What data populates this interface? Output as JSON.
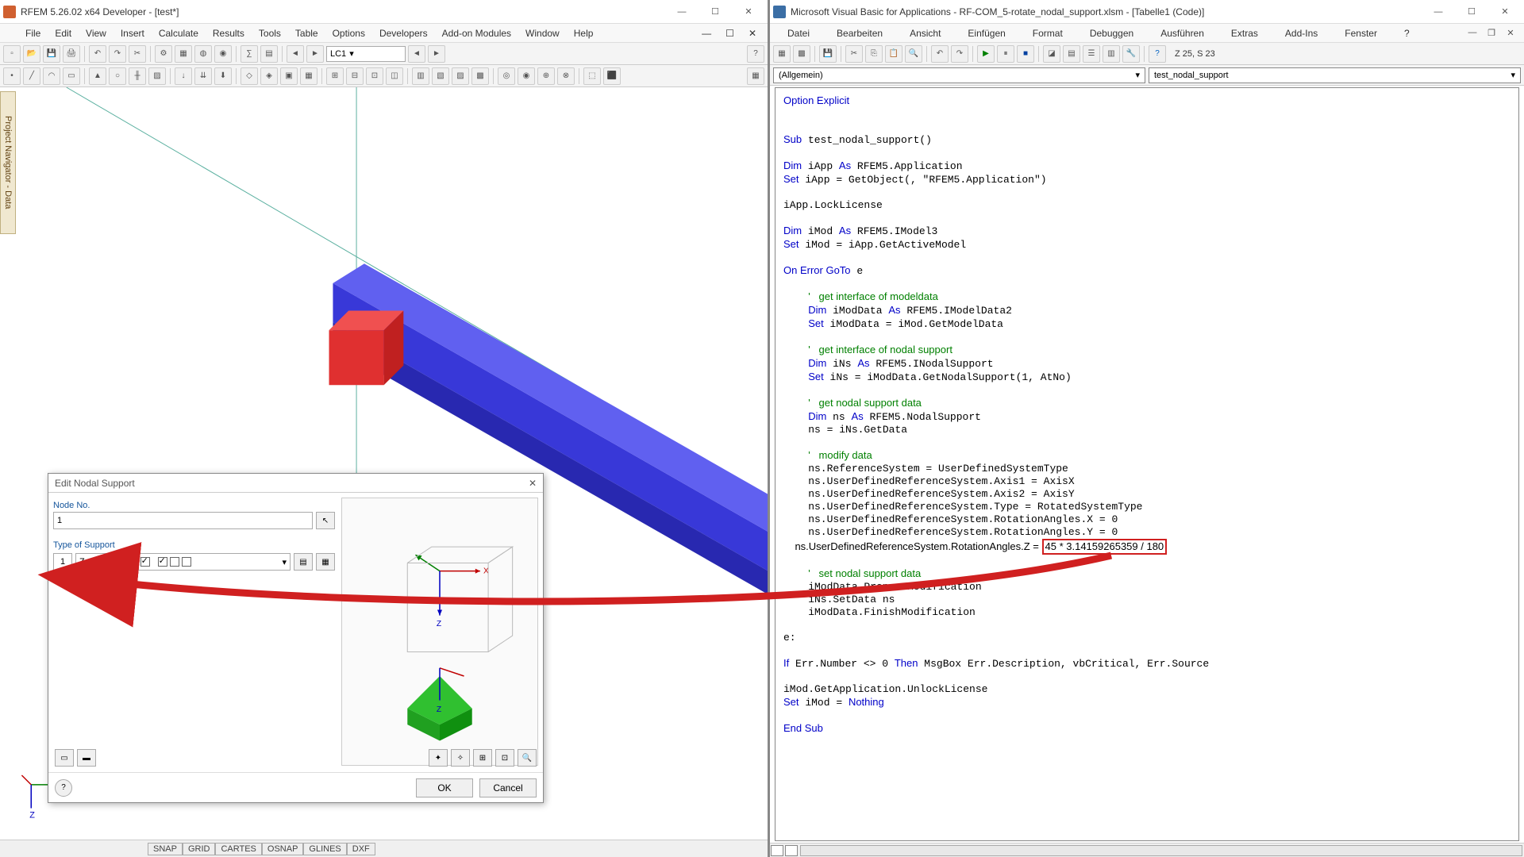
{
  "left": {
    "title": "RFEM 5.26.02 x64 Developer - [test*]",
    "menus": [
      "File",
      "Edit",
      "View",
      "Insert",
      "Calculate",
      "Results",
      "Tools",
      "Table",
      "Options",
      "Developers",
      "Add-on Modules",
      "Window",
      "Help"
    ],
    "toolbar_combo": "LC1",
    "side_tab": "Project Navigator - Data",
    "status": [
      "SNAP",
      "GRID",
      "CARTES",
      "OSNAP",
      "GLINES",
      "DXF"
    ]
  },
  "dialog": {
    "title": "Edit Nodal Support",
    "node_label": "Node No.",
    "node_value": "1",
    "type_label": "Type of Support",
    "type_num": "1",
    "type_text": "Z 45.0 °",
    "ok": "OK",
    "cancel": "Cancel"
  },
  "right": {
    "title": "Microsoft Visual Basic for Applications - RF-COM_5-rotate_nodal_support.xlsm - [Tabelle1 (Code)]",
    "menus": [
      "Datei",
      "Bearbeiten",
      "Ansicht",
      "Einfügen",
      "Format",
      "Debuggen",
      "Ausführen",
      "Extras",
      "Add-Ins",
      "Fenster",
      "?"
    ],
    "cursor": "Z 25, S 23",
    "combo_left": "(Allgemein)",
    "combo_right": "test_nodal_support",
    "highlight": "45 * 3.14159265359 / 180",
    "code_lines": {
      "l0": "Option Explicit",
      "l1": "Sub test_nodal_support()",
      "l2": "Dim iApp As RFEM5.Application",
      "l3": "Set iApp = GetObject(, \"RFEM5.Application\")",
      "l4": "iApp.LockLicense",
      "l5": "Dim iMod As RFEM5.IModel3",
      "l6": "Set iMod = iApp.GetActiveModel",
      "l7": "On Error GoTo e",
      "l8": "'   get interface of modeldata",
      "l9": "Dim iModData As RFEM5.IModelData2",
      "l10": "Set iModData = iMod.GetModelData",
      "l11": "'   get interface of nodal support",
      "l12": "Dim iNs As RFEM5.INodalSupport",
      "l13": "Set iNs = iModData.GetNodalSupport(1, AtNo)",
      "l14": "'   get nodal support data",
      "l15": "Dim ns As RFEM5.NodalSupport",
      "l16": "ns = iNs.GetData",
      "l17": "'   modify data",
      "l18": "ns.ReferenceSystem = UserDefinedSystemType",
      "l19": "ns.UserDefinedReferenceSystem.Axis1 = AxisX",
      "l20": "ns.UserDefinedReferenceSystem.Axis2 = AxisY",
      "l21": "ns.UserDefinedReferenceSystem.Type = RotatedSystemType",
      "l22": "ns.UserDefinedReferenceSystem.RotationAngles.X = 0",
      "l23": "ns.UserDefinedReferenceSystem.RotationAngles.Y = 0",
      "l24_prefix": "    ns.UserDefinedReferenceSystem.RotationAngles.Z = ",
      "l25": "'   set nodal support data",
      "l26": "iModData.PrepareModification",
      "l27": "iNs.SetData ns",
      "l28": "iModData.FinishModification",
      "l29": "e:",
      "l30": "If Err.Number <> 0 Then MsgBox Err.Description, vbCritical, Err.Source",
      "l31": "iMod.GetApplication.UnlockLicense",
      "l32": "Set iMod = Nothing",
      "l33": "End Sub"
    }
  }
}
